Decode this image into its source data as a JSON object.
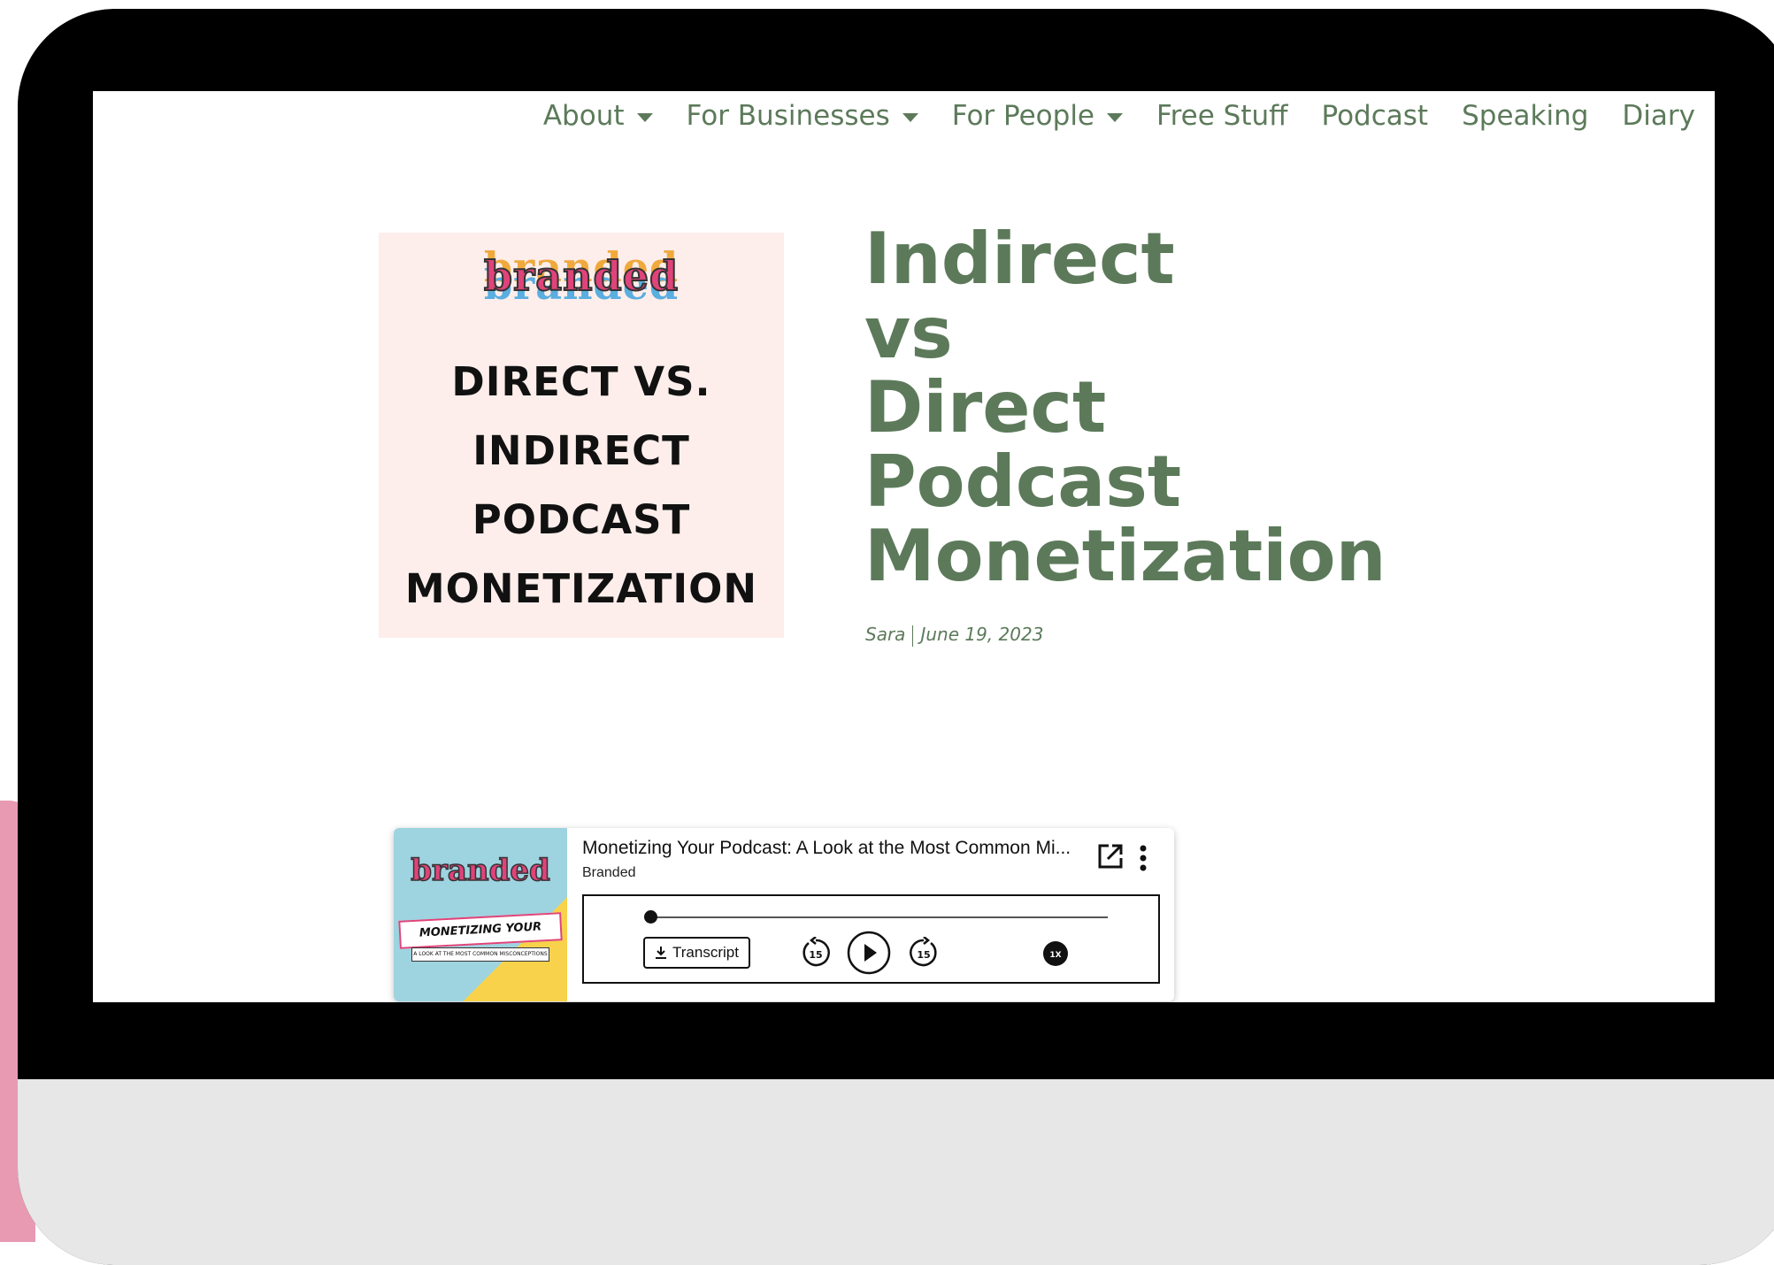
{
  "nav": {
    "items": [
      {
        "label": "About",
        "dropdown": true
      },
      {
        "label": "For Businesses",
        "dropdown": true
      },
      {
        "label": "For People",
        "dropdown": true
      },
      {
        "label": "Free Stuff",
        "dropdown": false
      },
      {
        "label": "Podcast",
        "dropdown": false
      },
      {
        "label": "Speaking",
        "dropdown": false
      },
      {
        "label": "Diary",
        "dropdown": false
      }
    ]
  },
  "cover": {
    "logo": "branded",
    "lines": [
      "DIRECT VS.",
      "INDIRECT",
      "PODCAST",
      "MONETIZATION"
    ]
  },
  "post": {
    "title_lines": [
      "Indirect",
      "vs",
      "Direct",
      "Podcast",
      "Monetization"
    ],
    "author": "Sara",
    "date": "June 19, 2023"
  },
  "player": {
    "art_logo": "branded",
    "art_band": "MONETIZING YOUR PODCAST",
    "art_sub": "A LOOK AT THE MOST COMMON MISCONCEPTIONS",
    "episode_title": "Monetizing Your Podcast: A Look at the Most Common Mi...",
    "show": "Branded",
    "transcript_label": "Transcript",
    "skip_back": "15",
    "skip_forward": "15",
    "speed": "1X",
    "progress": 0.0
  },
  "colors": {
    "accent": "#5c7a5a",
    "cover_bg": "#fdeeeb",
    "brand_pink": "#e0437a",
    "monitor_bezel": "#000000",
    "monitor_chin": "#e7e7e7",
    "deco_pink": "#e89ab3"
  },
  "icons": [
    "caret-down-icon",
    "external-link-icon",
    "more-vertical-icon",
    "download-icon",
    "rewind-15-icon",
    "play-icon",
    "forward-15-icon",
    "playback-speed-icon"
  ]
}
